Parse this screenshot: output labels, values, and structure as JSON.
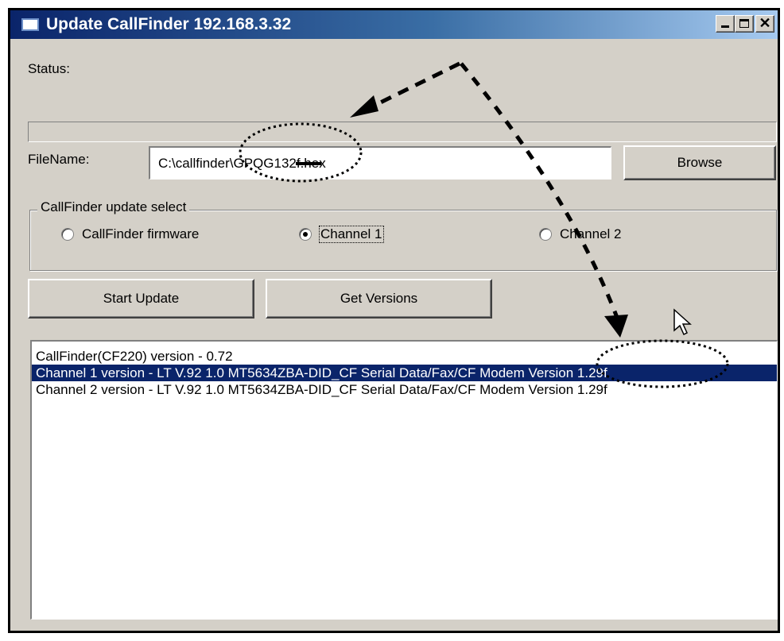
{
  "window": {
    "title": "Update CallFinder 192.168.3.32",
    "controls": {
      "minimize": "_",
      "maximize": "□",
      "close": "✕"
    }
  },
  "status": {
    "label": "Status:",
    "progress": 0
  },
  "file": {
    "label": "FileName:",
    "value": "C:\\callfinder\\GPQG132f.hex",
    "browse_label": "Browse"
  },
  "update_select": {
    "legend": "CallFinder update select",
    "options": [
      {
        "label": "CallFinder firmware",
        "checked": false
      },
      {
        "label": "Channel 1",
        "checked": true
      },
      {
        "label": "Channel 2",
        "checked": false
      }
    ]
  },
  "actions": {
    "start_update": "Start Update",
    "get_versions": "Get Versions"
  },
  "versions": {
    "items": [
      "CallFinder(CF220) version - 0.72",
      "Channel 1 version - LT V.92 1.0 MT5634ZBA-DID_CF Serial Data/Fax/CF Modem Version 1.29f",
      "Channel 2 version - LT V.92 1.0 MT5634ZBA-DID_CF Serial Data/Fax/CF Modem Version 1.29f"
    ],
    "selected_index": 1
  },
  "colors": {
    "titlebar": "#0a246a",
    "face": "#d4d0c8",
    "selection": "#0a246a"
  }
}
